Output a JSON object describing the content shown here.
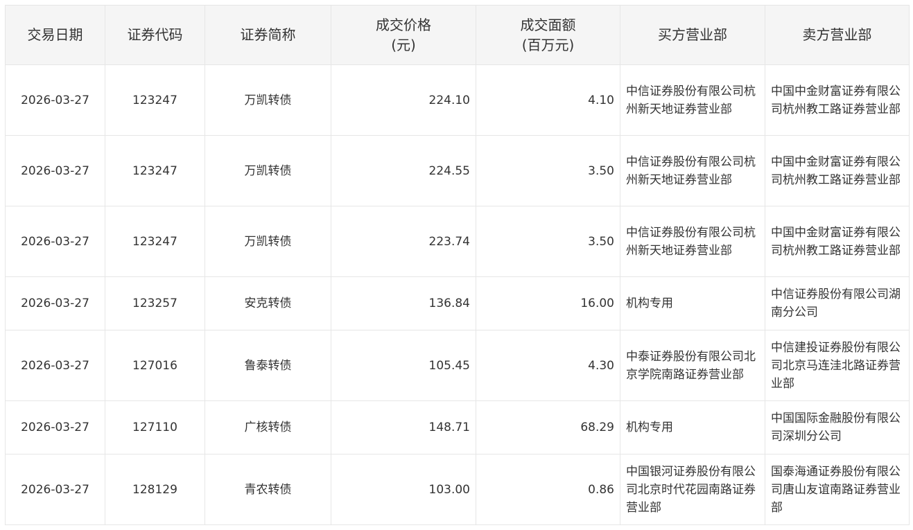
{
  "table": {
    "headers": [
      {
        "line1": "交易日期",
        "line2": ""
      },
      {
        "line1": "证券代码",
        "line2": ""
      },
      {
        "line1": "证券简称",
        "line2": ""
      },
      {
        "line1": "成交价格",
        "line2": "(元)"
      },
      {
        "line1": "成交面额",
        "line2": "(百万元)"
      },
      {
        "line1": "买方营业部",
        "line2": ""
      },
      {
        "line1": "卖方营业部",
        "line2": ""
      }
    ],
    "rows": [
      [
        "2026-03-27",
        "123247",
        "万凯转债",
        "224.10",
        "4.10",
        "中信证券股份有限公司杭州新天地证券营业部",
        "中国中金财富证券有限公司杭州教工路证券营业部"
      ],
      [
        "2026-03-27",
        "123247",
        "万凯转债",
        "224.55",
        "3.50",
        "中信证券股份有限公司杭州新天地证券营业部",
        "中国中金财富证券有限公司杭州教工路证券营业部"
      ],
      [
        "2026-03-27",
        "123247",
        "万凯转债",
        "223.74",
        "3.50",
        "中信证券股份有限公司杭州新天地证券营业部",
        "中国中金财富证券有限公司杭州教工路证券营业部"
      ],
      [
        "2026-03-27",
        "123257",
        "安克转债",
        "136.84",
        "16.00",
        "机构专用",
        "中信证券股份有限公司湖南分公司"
      ],
      [
        "2026-03-27",
        "127016",
        "鲁泰转债",
        "105.45",
        "4.30",
        "中泰证券股份有限公司北京学院南路证券营业部",
        "中信建投证券股份有限公司北京马连洼北路证券营业部"
      ],
      [
        "2026-03-27",
        "127110",
        "广核转债",
        "148.71",
        "68.29",
        "机构专用",
        "中国国际金融股份有限公司深圳分公司"
      ],
      [
        "2026-03-27",
        "128129",
        "青农转债",
        "103.00",
        "0.86",
        "中国银河证券股份有限公司北京时代花园南路证券营业部",
        "国泰海通证券股份有限公司唐山友谊南路证券营业部"
      ]
    ]
  }
}
